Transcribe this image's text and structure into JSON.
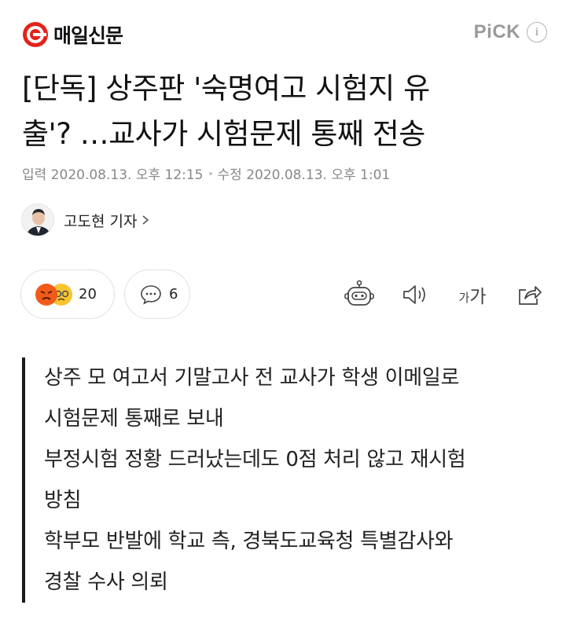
{
  "header": {
    "logo_text": "매일신문",
    "pick_label": "PiCK",
    "info_label": "i",
    "brand_color": "#e2231a"
  },
  "article": {
    "headline_line1": "[단독] 상주판 '숙명여고 시험지 유",
    "headline_line2": "출'? …교사가 시험문제 통째 전송",
    "published": "입력 2020.08.13. 오후 12:15",
    "modified": "수정 2020.08.13. 오후 1:01",
    "reporter": "고도현 기자"
  },
  "actions": {
    "reaction_count": "20",
    "comment_count": "6",
    "font_size_label_small": "가",
    "font_size_label_large": "가",
    "icons": [
      "angry-emoji-icon",
      "sad-emoji-icon",
      "comment-icon",
      "robot-icon",
      "speaker-icon",
      "share-icon"
    ]
  },
  "summary": {
    "lines": [
      "상주 모 여고서 기말고사 전 교사가 학생 이메일로",
      "시험문제 통째로 보내",
      "부정시험 정황 드러났는데도 0점 처리 않고 재시험",
      "방침",
      "학부모 반발에 학교 측, 경북도교육청 특별감사와",
      "경찰 수사 의뢰"
    ]
  }
}
